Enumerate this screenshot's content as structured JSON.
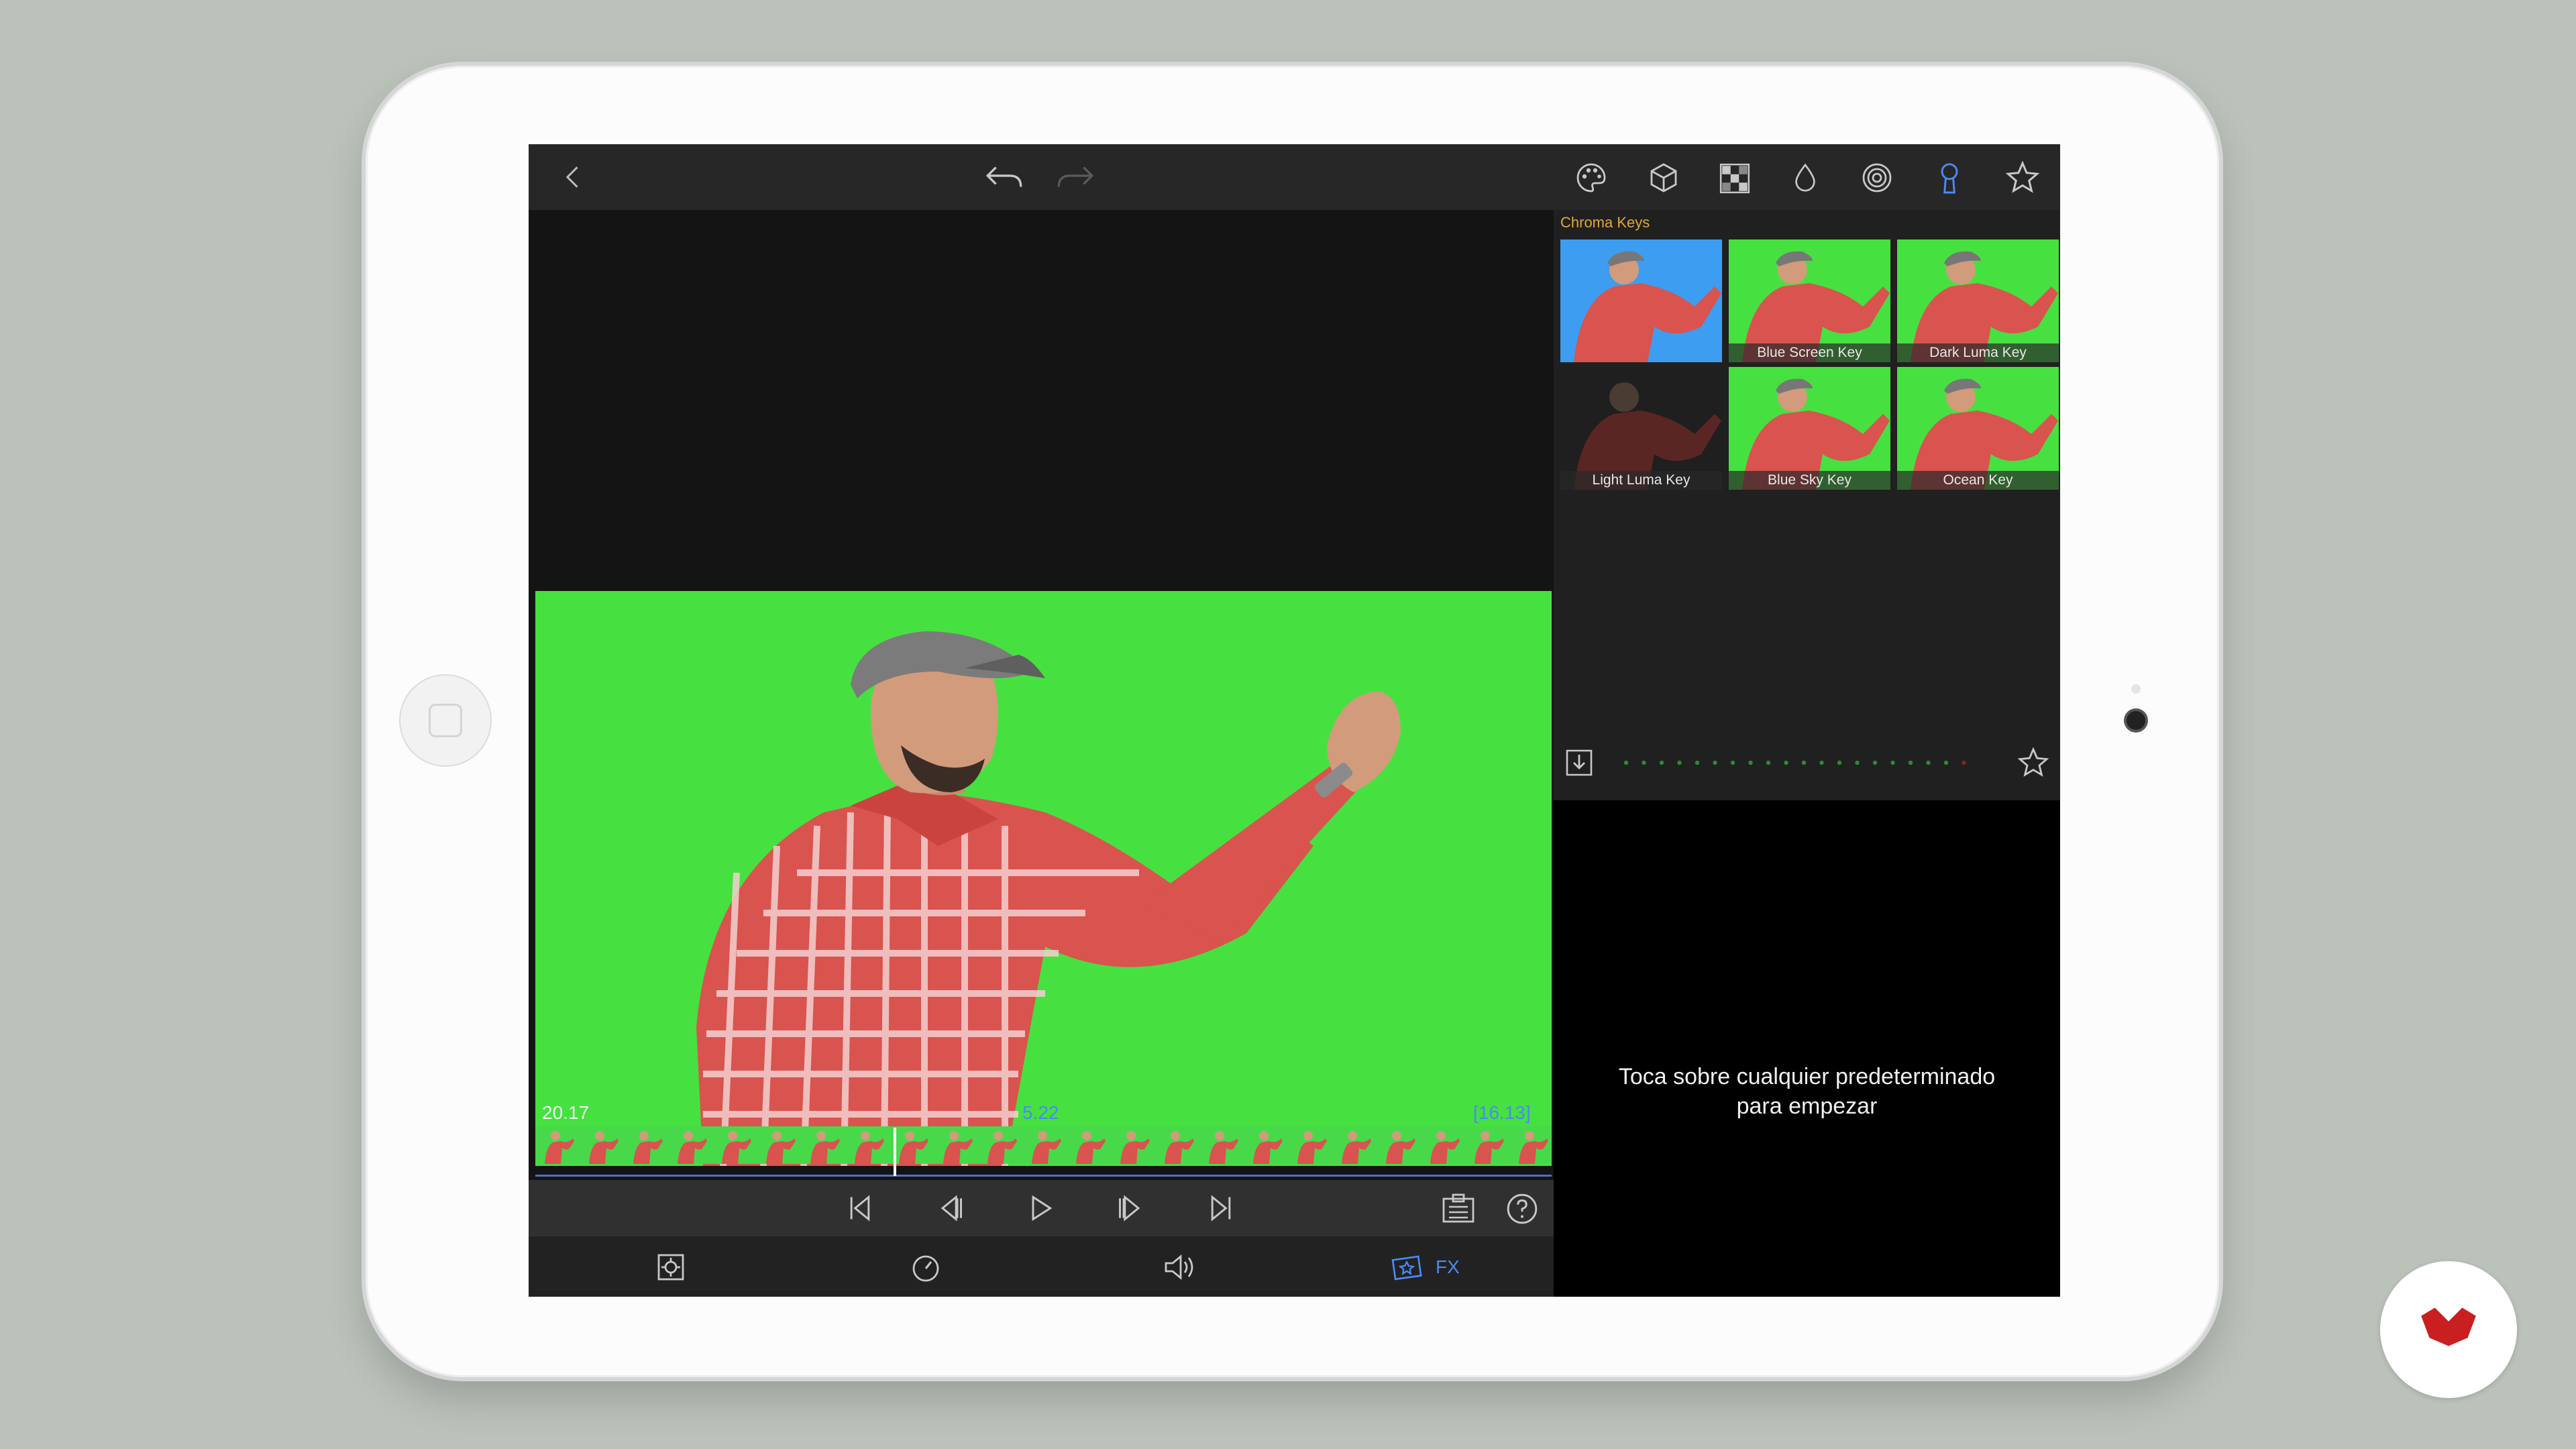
{
  "app": {
    "accent_color": "#4a8af4",
    "title_color": "#e0a83a"
  },
  "topbar": {
    "icons": [
      "back-icon",
      "undo-icon",
      "redo-icon",
      "palette-icon",
      "cube-icon",
      "grid-icon",
      "drop-icon",
      "spiral-icon",
      "keyhole-icon",
      "star-icon"
    ]
  },
  "presets": {
    "title": "Chroma Keys",
    "items": [
      {
        "label": "",
        "bg": "#3d9df0"
      },
      {
        "label": "Blue Screen Key",
        "bg": "#46e140"
      },
      {
        "label": "Dark Luma Key",
        "bg": "#46e140"
      },
      {
        "label": "Light Luma Key",
        "bg": "#1f1f1f"
      },
      {
        "label": "Blue Sky Key",
        "bg": "#46e140"
      },
      {
        "label": "Ocean Key",
        "bg": "#46e140"
      }
    ]
  },
  "hint": {
    "line1": "Toca sobre cualquier predeterminado",
    "line2": "para empezar"
  },
  "timeline": {
    "left_time": "20.17",
    "current_time": "5.22",
    "right_time": "[16.13]"
  },
  "bottom_toolbar": {
    "fx_label": "FX"
  }
}
